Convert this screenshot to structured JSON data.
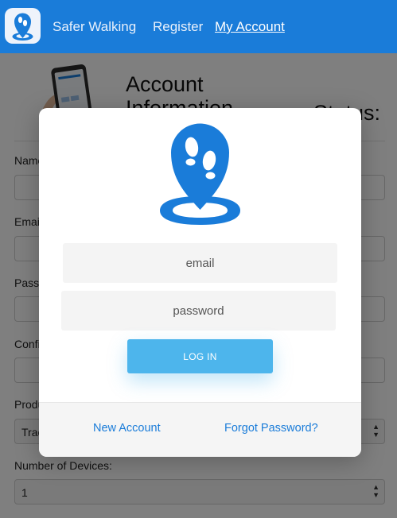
{
  "navbar": {
    "brand": "Safer Walking",
    "register": "Register",
    "my_account": "My Account",
    "color": "#1a7cd9"
  },
  "page": {
    "title": "Account Information",
    "status_label": "Status:",
    "fields": {
      "name_label": "Name:",
      "email_label": "Email:",
      "password_label": "Password:",
      "confirm_label": "Confirm Password:",
      "product_label": "Product:",
      "product_value": "Tracker",
      "devices_label": "Number of Devices:",
      "devices_value": "1"
    }
  },
  "modal": {
    "logo_icon": "footprints-location-pin-icon",
    "email_placeholder": "email",
    "password_placeholder": "password",
    "login_label": "LOG IN",
    "new_account": "New Account",
    "forgot_password": "Forgot Password?",
    "accent": "#4db5ec",
    "link_color": "#1a7cd9"
  }
}
